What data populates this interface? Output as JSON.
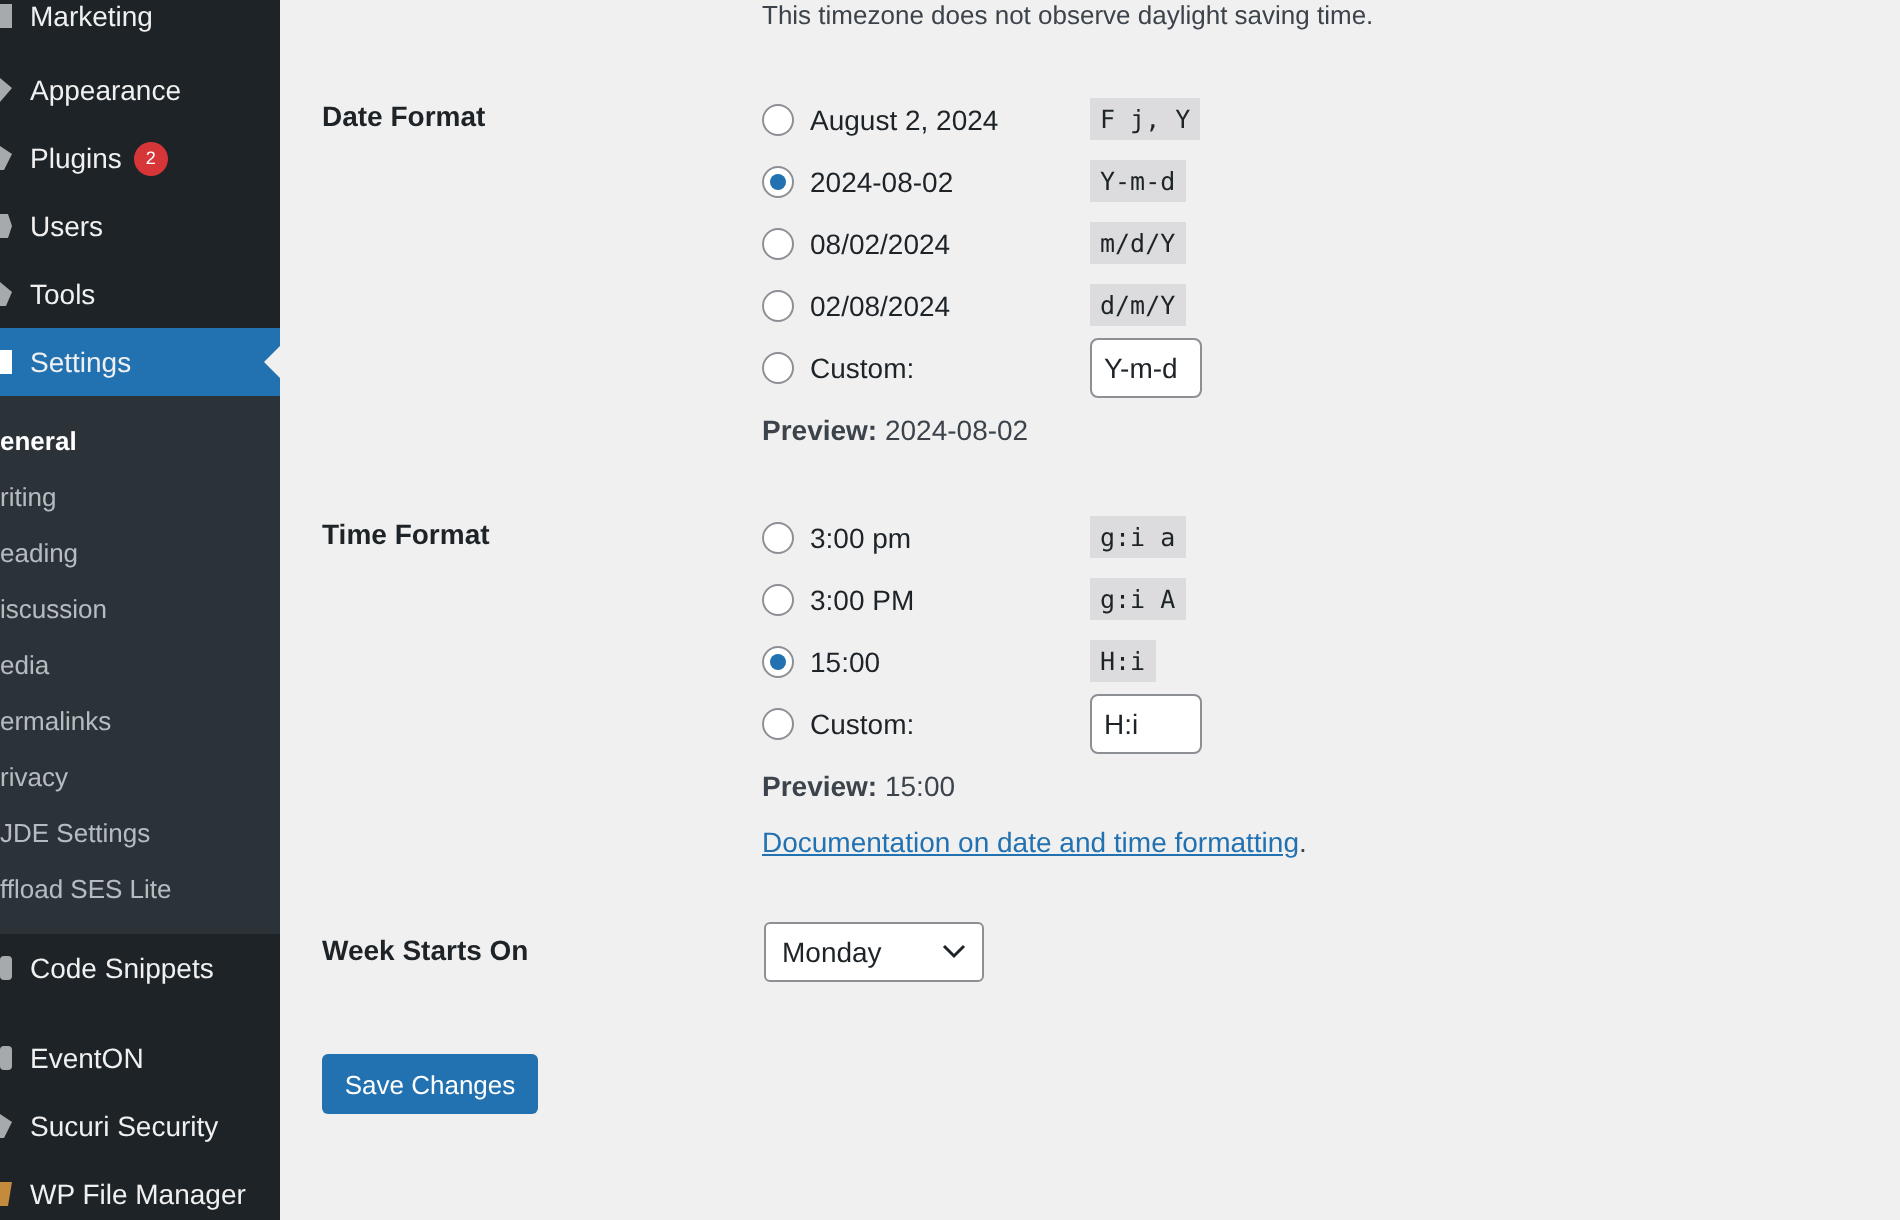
{
  "sidebar": {
    "items": [
      {
        "label": "Marketing",
        "selected": false
      },
      {
        "label": "Appearance",
        "selected": false
      },
      {
        "label": "Plugins",
        "badge": "2",
        "selected": false
      },
      {
        "label": "Users",
        "selected": false
      },
      {
        "label": "Tools",
        "selected": false
      },
      {
        "label": "Settings",
        "selected": true,
        "children": [
          {
            "label": "eneral",
            "selected": true
          },
          {
            "label": "riting",
            "selected": false
          },
          {
            "label": "eading",
            "selected": false
          },
          {
            "label": "iscussion",
            "selected": false
          },
          {
            "label": "edia",
            "selected": false
          },
          {
            "label": "ermalinks",
            "selected": false
          },
          {
            "label": "rivacy",
            "selected": false
          },
          {
            "label": "JDE Settings",
            "selected": false
          },
          {
            "label": "ffload SES Lite",
            "selected": false
          }
        ]
      },
      {
        "label": "Code Snippets",
        "selected": false
      },
      {
        "label": "EventON",
        "selected": false
      },
      {
        "label": "Sucuri Security",
        "selected": false
      },
      {
        "label": "WP File Manager",
        "selected": false
      }
    ]
  },
  "timezone_note": "This timezone does not observe daylight saving time.",
  "date_format": {
    "label": "Date Format",
    "options": [
      {
        "kind": "preset",
        "label": "August 2, 2024",
        "format": "F j, Y",
        "selected": false
      },
      {
        "kind": "preset",
        "label": "2024-08-02",
        "format": "Y-m-d",
        "selected": true
      },
      {
        "kind": "preset",
        "label": "08/02/2024",
        "format": "m/d/Y",
        "selected": false
      },
      {
        "kind": "preset",
        "label": "02/08/2024",
        "format": "d/m/Y",
        "selected": false
      },
      {
        "kind": "custom",
        "label": "Custom:",
        "value": "Y-m-d",
        "selected": false
      }
    ],
    "preview_label": "Preview:",
    "preview": "2024-08-02"
  },
  "time_format": {
    "label": "Time Format",
    "options": [
      {
        "kind": "preset",
        "label": "3:00 pm",
        "format": "g:i a",
        "selected": false
      },
      {
        "kind": "preset",
        "label": "3:00 PM",
        "format": "g:i A",
        "selected": false
      },
      {
        "kind": "preset",
        "label": "15:00",
        "format": "H:i",
        "selected": true
      },
      {
        "kind": "custom",
        "label": "Custom:",
        "value": "H:i",
        "selected": false
      }
    ],
    "preview_label": "Preview:",
    "preview": "15:00",
    "doc_link": "Documentation on date and time formatting",
    "doc_suffix": "."
  },
  "week_starts_on": {
    "label": "Week Starts On",
    "value": "Monday"
  },
  "save_button": "Save Changes"
}
